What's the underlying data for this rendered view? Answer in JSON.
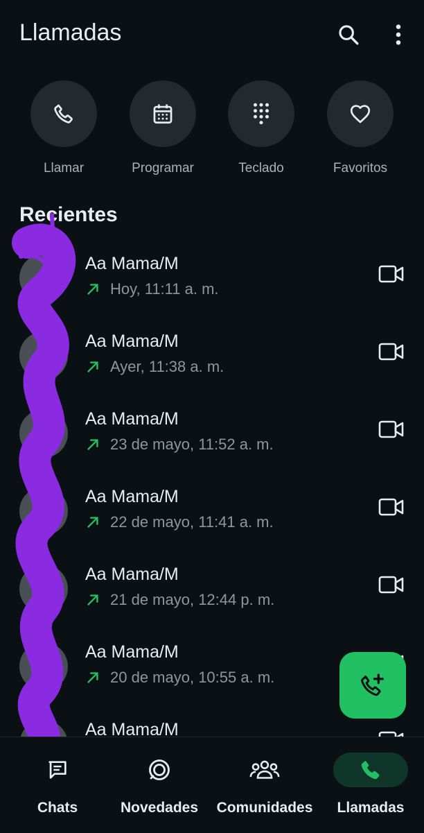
{
  "header": {
    "title": "Llamadas",
    "search_icon": "search-icon",
    "menu_icon": "more-vert-icon"
  },
  "quick_actions": [
    {
      "label": "Llamar",
      "icon": "phone-icon"
    },
    {
      "label": "Programar",
      "icon": "calendar-icon"
    },
    {
      "label": "Teclado",
      "icon": "dialpad-icon"
    },
    {
      "label": "Favoritos",
      "icon": "heart-icon"
    }
  ],
  "recents": {
    "title": "Recientes",
    "items": [
      {
        "name": "Aa Mama/M",
        "time": "Hoy, 11:11 a. m."
      },
      {
        "name": "Aa Mama/M",
        "time": "Ayer, 11:38 a. m."
      },
      {
        "name": "Aa Mama/M",
        "time": "23 de mayo, 11:52 a. m."
      },
      {
        "name": "Aa Mama/M",
        "time": "22 de mayo, 11:41 a. m."
      },
      {
        "name": "Aa Mama/M",
        "time": "21 de mayo, 12:44 p. m."
      },
      {
        "name": "Aa Mama/M",
        "time": "20 de mayo, 10:55 a. m."
      },
      {
        "name": "Aa Mama/M",
        "time": ""
      }
    ]
  },
  "colors": {
    "accent": "#21c063",
    "background": "#0b1014",
    "outgoing_arrow": "#21c063",
    "scribble": "#8a2be2"
  },
  "bottom_nav": [
    {
      "label": "Chats",
      "icon": "chats-icon"
    },
    {
      "label": "Novedades",
      "icon": "updates-icon"
    },
    {
      "label": "Comunidades",
      "icon": "communities-icon"
    },
    {
      "label": "Llamadas",
      "icon": "calls-icon",
      "active": true
    }
  ]
}
